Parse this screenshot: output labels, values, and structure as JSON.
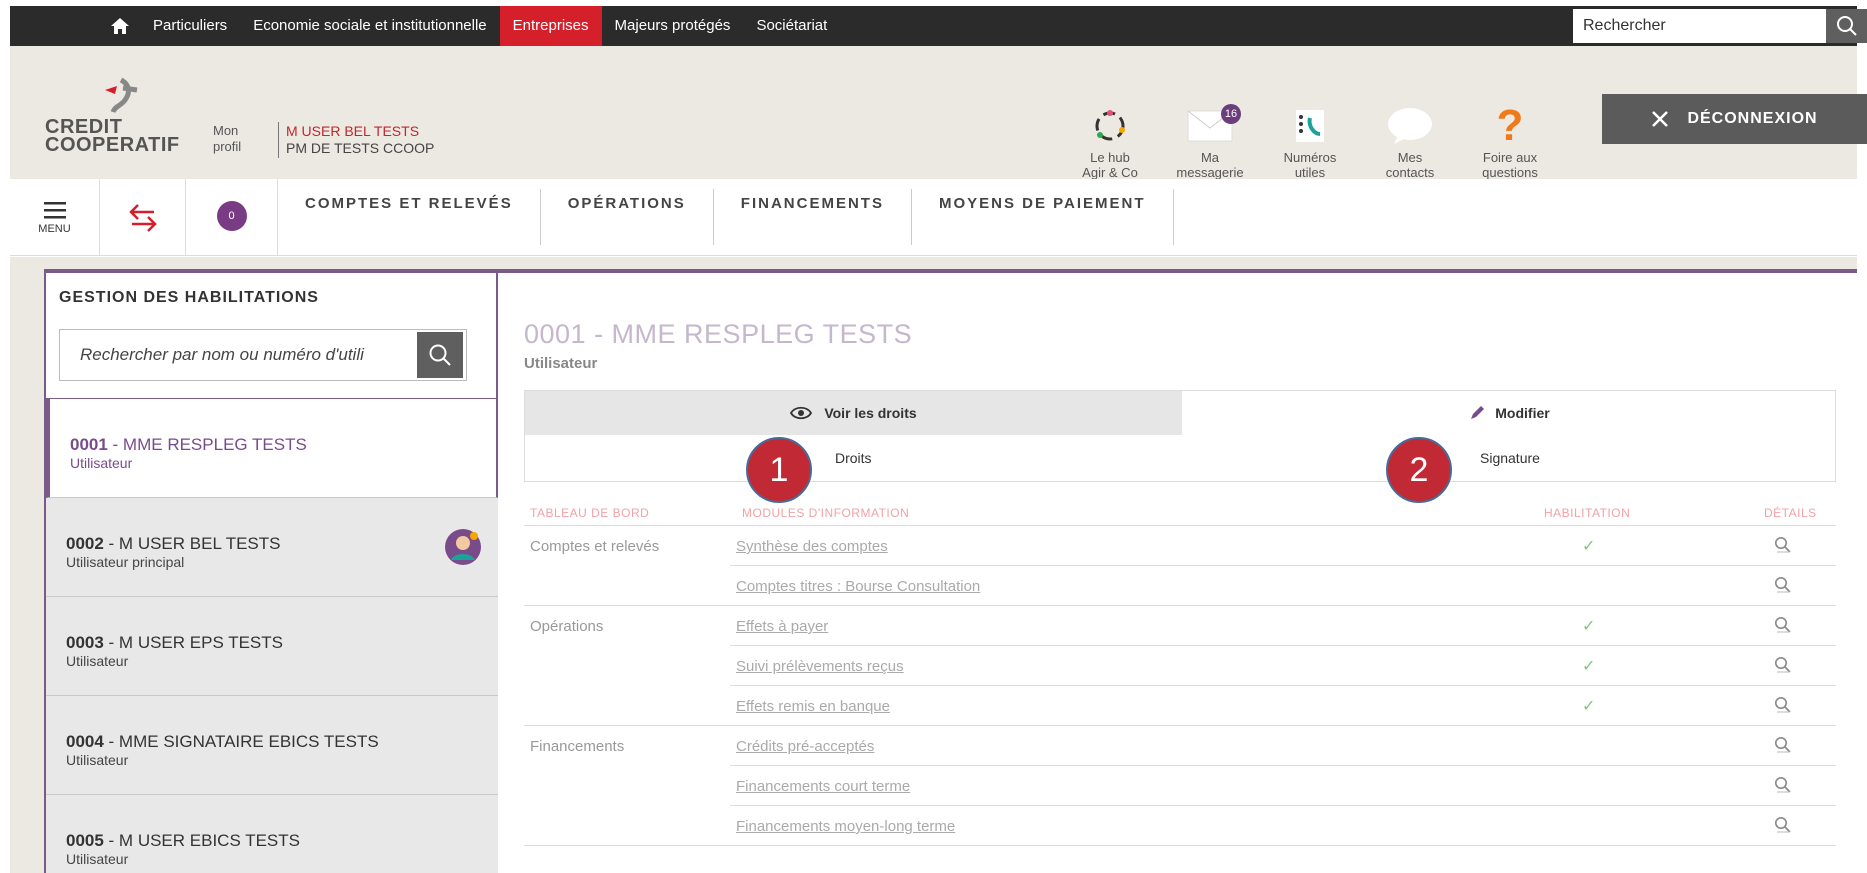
{
  "topnav": {
    "items": [
      "Particuliers",
      "Economie sociale et institutionnelle",
      "Entreprises",
      "Majeurs protégés",
      "Sociétariat"
    ],
    "active": "Entreprises",
    "search_placeholder": "Rechercher"
  },
  "header": {
    "logo_line1": "CREDIT",
    "logo_line2": "COOPERATIF",
    "profile_line1": "Mon",
    "profile_line2": "profil",
    "user_name": "M USER BEL TESTS",
    "user_org": "PM DE TESTS CCOOP",
    "quick_links": [
      {
        "line1": "Le hub",
        "line2": "Agir & Co",
        "icon": "hub-icon"
      },
      {
        "line1": "Ma",
        "line2": "messagerie",
        "icon": "envelope-icon",
        "badge": "16"
      },
      {
        "line1": "Numéros",
        "line2": "utiles",
        "icon": "phone-book-icon"
      },
      {
        "line1": "Mes",
        "line2": "contacts",
        "icon": "speech-bubble-icon"
      },
      {
        "line1": "Foire aux",
        "line2": "questions",
        "icon": "question-icon"
      }
    ],
    "logout_label": "DÉCONNEXION"
  },
  "mainnav": {
    "menu_label": "MENU",
    "counter": "0",
    "tabs": [
      "COMPTES ET RELEVÉS",
      "OPÉRATIONS",
      "FINANCEMENTS",
      "MOYENS DE PAIEMENT"
    ]
  },
  "sidebar": {
    "title": "GESTION DES HABILITATIONS",
    "search_placeholder": "Rechercher par nom ou numéro d'utili",
    "users": [
      {
        "code": "0001",
        "name": " - MME RESPLEG TESTS",
        "role": "Utilisateur"
      },
      {
        "code": "0002",
        "name": " - M USER BEL TESTS",
        "role": "Utilisateur principal"
      },
      {
        "code": "0003",
        "name": " - M USER EPS TESTS",
        "role": "Utilisateur"
      },
      {
        "code": "0004",
        "name": " - MME SIGNATAIRE EBICS TESTS",
        "role": "Utilisateur"
      },
      {
        "code": "0005",
        "name": " - M USER EBICS TESTS",
        "role": "Utilisateur"
      }
    ]
  },
  "detail": {
    "title": "0001 - MME RESPLEG TESTS",
    "subtitle": "Utilisateur",
    "tab_voir": "Voir les droits",
    "tab_modifier": "Modifier",
    "sub_droits": "Droits",
    "sub_signature": "Signature",
    "marker1": "1",
    "marker2": "2"
  },
  "table": {
    "headers": {
      "col1": "TABLEAU DE BORD",
      "col2": "MODULES D'INFORMATION",
      "col3": "HABILITATION",
      "col4": "DÉTAILS"
    },
    "rows": [
      {
        "category": "Comptes et relevés",
        "module": "Synthèse des comptes",
        "check": "✓"
      },
      {
        "category": "",
        "module": "Comptes titres : Bourse Consultation",
        "check": ""
      },
      {
        "category": "Opérations",
        "module": "Effets à payer",
        "check": "✓"
      },
      {
        "category": "",
        "module": "Suivi prélèvements reçus",
        "check": "✓"
      },
      {
        "category": "",
        "module": "Effets remis en banque",
        "check": "✓"
      },
      {
        "category": "Financements",
        "module": "Crédits pré-acceptés",
        "check": ""
      },
      {
        "category": "",
        "module": "Financements court terme",
        "check": ""
      },
      {
        "category": "",
        "module": "Financements moyen-long terme",
        "check": ""
      }
    ]
  }
}
